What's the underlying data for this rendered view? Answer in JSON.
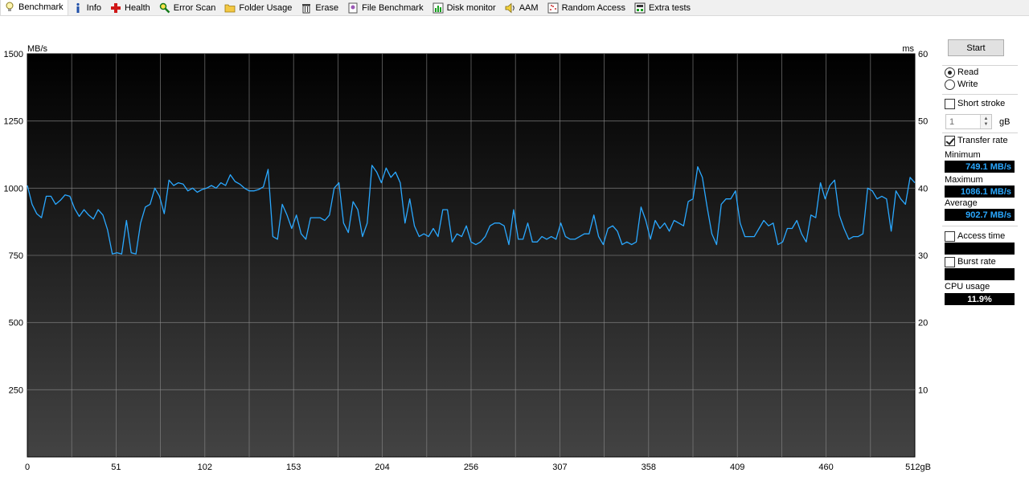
{
  "tabs": [
    {
      "label": "Benchmark",
      "icon": "lightbulb-icon",
      "active": true
    },
    {
      "label": "Info",
      "icon": "info-icon",
      "active": false
    },
    {
      "label": "Health",
      "icon": "health-cross-icon",
      "active": false
    },
    {
      "label": "Error Scan",
      "icon": "magnifier-icon",
      "active": false
    },
    {
      "label": "Folder Usage",
      "icon": "folder-icon",
      "active": false
    },
    {
      "label": "Erase",
      "icon": "trash-icon",
      "active": false
    },
    {
      "label": "File Benchmark",
      "icon": "file-benchmark-icon",
      "active": false
    },
    {
      "label": "Disk monitor",
      "icon": "disk-monitor-icon",
      "active": false
    },
    {
      "label": "AAM",
      "icon": "speaker-icon",
      "active": false
    },
    {
      "label": "Random Access",
      "icon": "random-access-icon",
      "active": false
    },
    {
      "label": "Extra tests",
      "icon": "extra-tests-icon",
      "active": false
    }
  ],
  "panel": {
    "start_label": "Start",
    "read_label": "Read",
    "write_label": "Write",
    "read_selected": true,
    "short_stroke_label": "Short stroke",
    "short_stroke_checked": false,
    "short_stroke_value": "1",
    "short_stroke_unit": "gB",
    "transfer_rate_label": "Transfer rate",
    "transfer_rate_checked": true,
    "minimum_label": "Minimum",
    "minimum_value": "749.1 MB/s",
    "maximum_label": "Maximum",
    "maximum_value": "1086.1 MB/s",
    "average_label": "Average",
    "average_value": "902.7 MB/s",
    "access_time_label": "Access time",
    "access_time_checked": false,
    "access_time_value": "",
    "burst_rate_label": "Burst rate",
    "burst_rate_checked": false,
    "burst_rate_value": "",
    "cpu_usage_label": "CPU usage",
    "cpu_usage_value": "11.9%"
  },
  "colors": {
    "plot_top": "#000000",
    "plot_bottom": "#434343",
    "grid": "#8a8a8a",
    "series": "#2aa8ff",
    "stat_text": "#2aa8ff"
  },
  "chart_data": {
    "type": "line",
    "xlabel_unit": "gB",
    "y_left_unit": "MB/s",
    "y_right_unit": "ms",
    "ylim": [
      0,
      1500
    ],
    "y2lim": [
      0,
      60
    ],
    "xlim": [
      0,
      512
    ],
    "x_ticks": [
      "0",
      "51",
      "102",
      "153",
      "204",
      "256",
      "307",
      "358",
      "409",
      "460",
      "512gB"
    ],
    "y_ticks": [
      "1500",
      "1250",
      "1000",
      "750",
      "500",
      "250"
    ],
    "y2_ticks": [
      "60",
      "50",
      "40",
      "30",
      "20",
      "10"
    ],
    "series": [
      {
        "values": [
          1010,
          940,
          905,
          890,
          970,
          970,
          940,
          955,
          975,
          970,
          925,
          895,
          920,
          900,
          885,
          920,
          900,
          845,
          755,
          760,
          755,
          880,
          760,
          755,
          870,
          930,
          940,
          1000,
          970,
          905,
          1030,
          1010,
          1020,
          1015,
          990,
          1000,
          985,
          995,
          1000,
          1010,
          1000,
          1020,
          1010,
          1050,
          1025,
          1015,
          1000,
          990,
          990,
          995,
          1005,
          1070,
          820,
          810,
          940,
          900,
          850,
          900,
          830,
          810,
          890,
          890,
          890,
          880,
          900,
          1000,
          1020,
          870,
          835,
          950,
          920,
          820,
          870,
          1085,
          1060,
          1020,
          1075,
          1040,
          1060,
          1020,
          870,
          960,
          860,
          820,
          830,
          820,
          850,
          820,
          920,
          920,
          800,
          830,
          820,
          860,
          800,
          790,
          800,
          820,
          860,
          870,
          870,
          860,
          790,
          920,
          810,
          810,
          870,
          800,
          800,
          820,
          810,
          820,
          810,
          870,
          820,
          810,
          810,
          820,
          830,
          830,
          900,
          820,
          790,
          850,
          860,
          840,
          790,
          800,
          790,
          800,
          930,
          880,
          810,
          880,
          850,
          870,
          840,
          880,
          870,
          860,
          950,
          960,
          1080,
          1040,
          930,
          830,
          790,
          940,
          960,
          960,
          990,
          870,
          820,
          820,
          820,
          850,
          880,
          860,
          870,
          790,
          800,
          850,
          850,
          880,
          830,
          800,
          900,
          890,
          1020,
          960,
          1010,
          1030,
          900,
          850,
          810,
          820,
          820,
          830,
          1000,
          990,
          960,
          970,
          960,
          840,
          990,
          960,
          940,
          1040,
          1020
        ]
      }
    ]
  }
}
